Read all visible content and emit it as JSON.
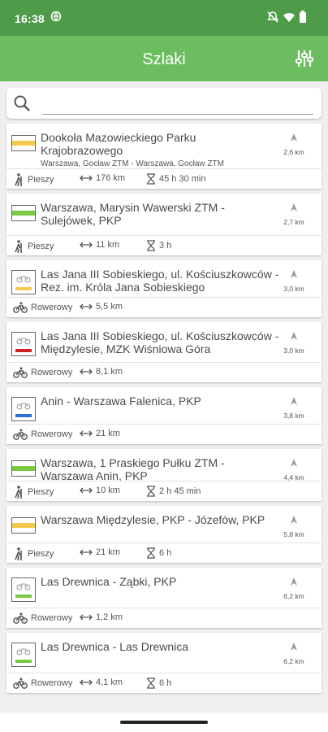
{
  "status": {
    "time": "16:38"
  },
  "app": {
    "title": "Szlaki"
  },
  "search": {
    "placeholder": ""
  },
  "trails": [
    {
      "name": "Dookoła Mazowieckiego Parku Krajobrazowego",
      "sub": "Warszawa, Gocław ZTM - Warszawa, Gocław ZTM",
      "distance": "2,6 km",
      "mode": "Pieszy",
      "length": "176 km",
      "time": "45 h 30 min",
      "badge": "walk",
      "color": "#f2c94c"
    },
    {
      "name": "Warszawa, Marysin Wawerski ZTM - Sulejówek, PKP",
      "sub": "",
      "distance": "2,7 km",
      "mode": "Pieszy",
      "length": "11 km",
      "time": "3 h",
      "badge": "walk",
      "color": "#7ac943"
    },
    {
      "name": "Las Jana III Sobieskiego, ul. Kościuszkowców - Rez. im. Króla Jana Sobieskiego",
      "sub": "",
      "distance": "3,0 km",
      "mode": "Rowerowy",
      "length": "5,5 km",
      "time": "",
      "badge": "bike",
      "color": "#f2c94c"
    },
    {
      "name": "Las Jana III Sobieskiego, ul. Kościuszkowców - Międzylesie, MZK Wiśniowa Góra",
      "sub": "",
      "distance": "3,0 km",
      "mode": "Rowerowy",
      "length": "8,1 km",
      "time": "",
      "badge": "bike",
      "color": "#cc2222"
    },
    {
      "name": "Anin - Warszawa Falenica, PKP",
      "sub": "",
      "distance": "3,8 km",
      "mode": "Rowerowy",
      "length": "21 km",
      "time": "",
      "badge": "bike",
      "color": "#2f6fd6"
    },
    {
      "name": "Warszawa, 1 Praskiego Pułku ZTM - Warszawa Anin, PKP",
      "sub": "",
      "distance": "4,4 km",
      "mode": "Pieszy",
      "length": "10 km",
      "time": "2 h 45 min",
      "badge": "walk",
      "color": "#7ac943"
    },
    {
      "name": "Warszawa Międzylesie, PKP - Józefów, PKP",
      "sub": "",
      "distance": "5,8 km",
      "mode": "Pieszy",
      "length": "21 km",
      "time": "6 h",
      "badge": "walk",
      "color": "#f2c94c"
    },
    {
      "name": "Las Drewnica - Ząbki, PKP",
      "sub": "",
      "distance": "6,2 km",
      "mode": "Rowerowy",
      "length": "1,2 km",
      "time": "",
      "badge": "bike",
      "color": "#7ac943"
    },
    {
      "name": "Las Drewnica - Las Drewnica",
      "sub": "",
      "distance": "6,2 km",
      "mode": "Rowerowy",
      "length": "4,1 km",
      "time": "6 h",
      "badge": "bike",
      "color": "#7ac943"
    }
  ]
}
